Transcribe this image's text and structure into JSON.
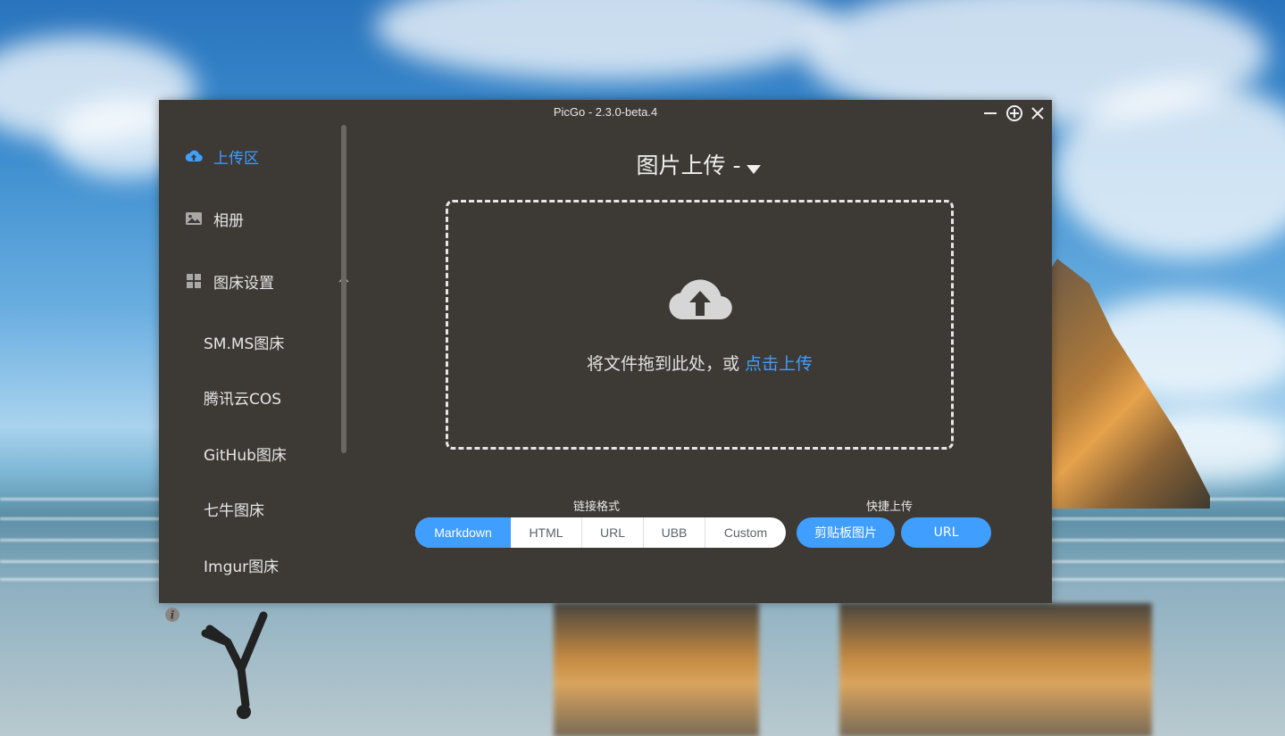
{
  "window": {
    "title": "PicGo - 2.3.0-beta.4",
    "controls": [
      "minimize-icon",
      "maximize-icon",
      "close-icon"
    ]
  },
  "sidebar": {
    "items": [
      {
        "label": "上传区",
        "icon": "cloud-upload-icon",
        "active": true
      },
      {
        "label": "相册",
        "icon": "image-icon",
        "active": false
      },
      {
        "label": "图床设置",
        "icon": "grid-icon",
        "active": false,
        "expanded": true
      }
    ],
    "sub_items": [
      "SM.MS图床",
      "腾讯云COS",
      "GitHub图床",
      "七牛图床",
      "Imgur图床"
    ],
    "info_icon": "info-icon"
  },
  "main": {
    "title": "图片上传 -",
    "dropzone": {
      "text": "将文件拖到此处，或 ",
      "link": "点击上传"
    },
    "link_format": {
      "label": "链接格式",
      "options": [
        "Markdown",
        "HTML",
        "URL",
        "UBB",
        "Custom"
      ],
      "selected": "Markdown"
    },
    "quick_upload": {
      "label": "快捷上传",
      "clipboard": "剪贴板图片",
      "url": "URL"
    }
  },
  "colors": {
    "accent": "#409eff",
    "window_bg": "#3d3935"
  }
}
